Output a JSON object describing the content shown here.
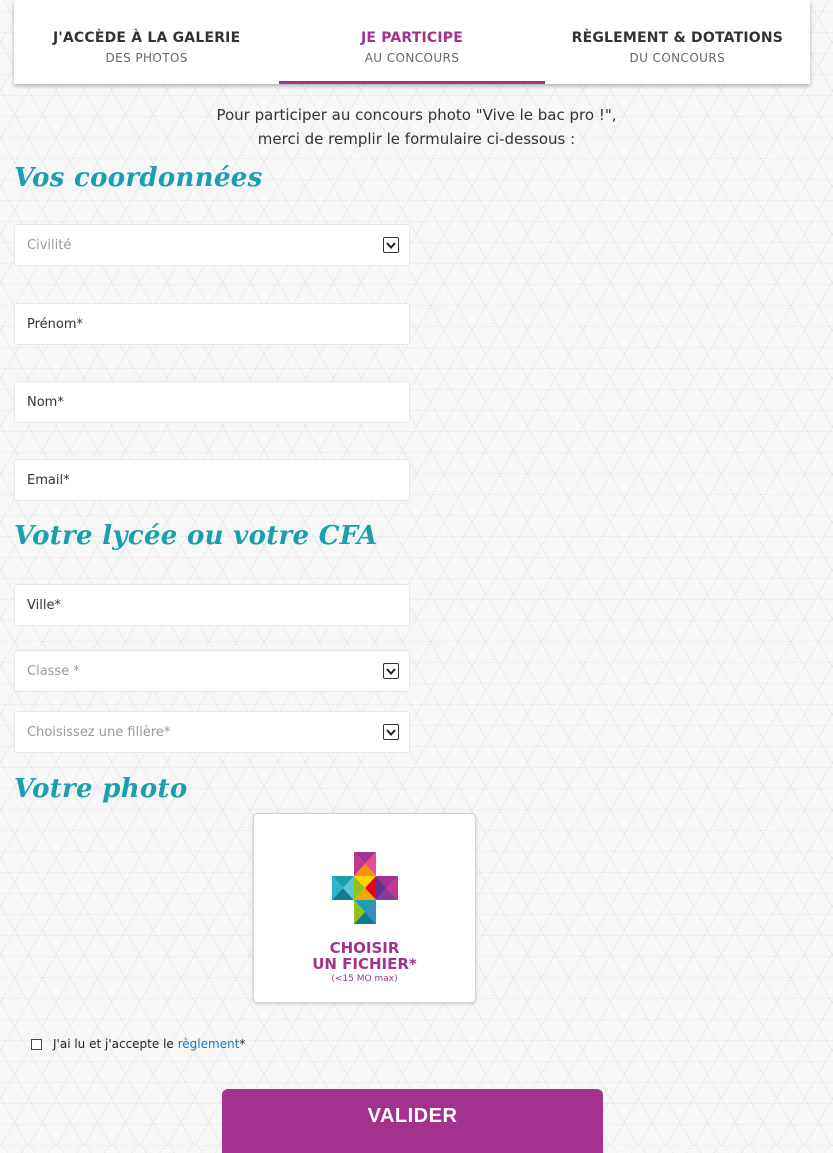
{
  "tabs": [
    {
      "line1": "J'ACCÈDE À LA GALERIE",
      "line2": "DES PHOTOS"
    },
    {
      "line1": "JE PARTICIPE",
      "line2": "AU CONCOURS"
    },
    {
      "line1": "RÈGLEMENT & DOTATIONS",
      "line2": "DU CONCOURS"
    }
  ],
  "active_tab": 1,
  "intro": {
    "line1": "Pour participer au concours photo \"Vive le bac pro !\",",
    "line2": "merci de remplir le formulaire ci-dessous :"
  },
  "sections": {
    "coordonnees": "Vos coordonnées",
    "lycee": "Votre lycée ou votre CFA",
    "photo": "Votre photo"
  },
  "fields": {
    "civilite": "Civilité",
    "prenom": "Prénom*",
    "nom": "Nom*",
    "email": "Email*",
    "ville": "Ville*",
    "classe": "Classe *",
    "filiere": "Choisissez une filière*"
  },
  "upload": {
    "line1": "CHOISIR",
    "line2": "UN FICHIER*",
    "hint": "(<15 MO max)",
    "icon": "colorful-plus-icon"
  },
  "consent": {
    "text": "J'ai lu et j'accepte le ",
    "link": "règlement",
    "asterisk": "*"
  },
  "submit_label": "VALIDER",
  "colors": {
    "accent": "#a3328f",
    "heading": "#1a9fae",
    "link": "#1b78b8"
  }
}
